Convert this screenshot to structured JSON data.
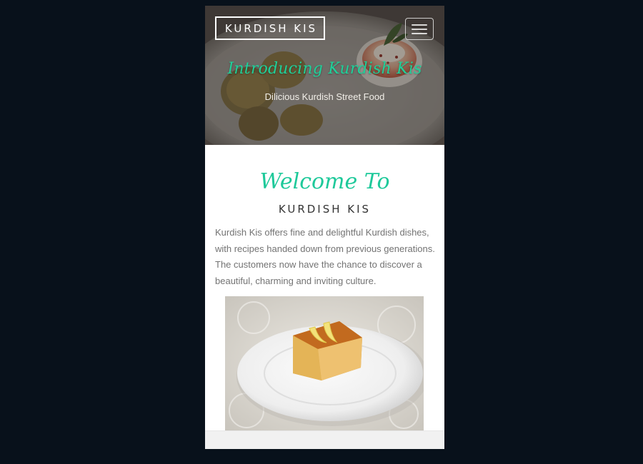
{
  "navbar": {
    "brand": "KURDISH KIS",
    "menu_icon": "hamburger-menu-icon"
  },
  "hero": {
    "title": "Introducing Kurdish Kis",
    "subtitle": "Dilicious Kurdish Street Food",
    "image": "kurdish-food-photo"
  },
  "welcome": {
    "title": "Welcome To",
    "subtitle": "KURDISH KIS",
    "text": "Kurdish Kis offers fine and delightful Kurdish dishes, with recipes handed down from previous generations. The customers now have the chance to discover a beautiful, charming and inviting culture.",
    "image": "dessert-photo"
  },
  "colors": {
    "accent": "#1ec99a",
    "page_background": "#08111b",
    "body_text": "#737373"
  }
}
